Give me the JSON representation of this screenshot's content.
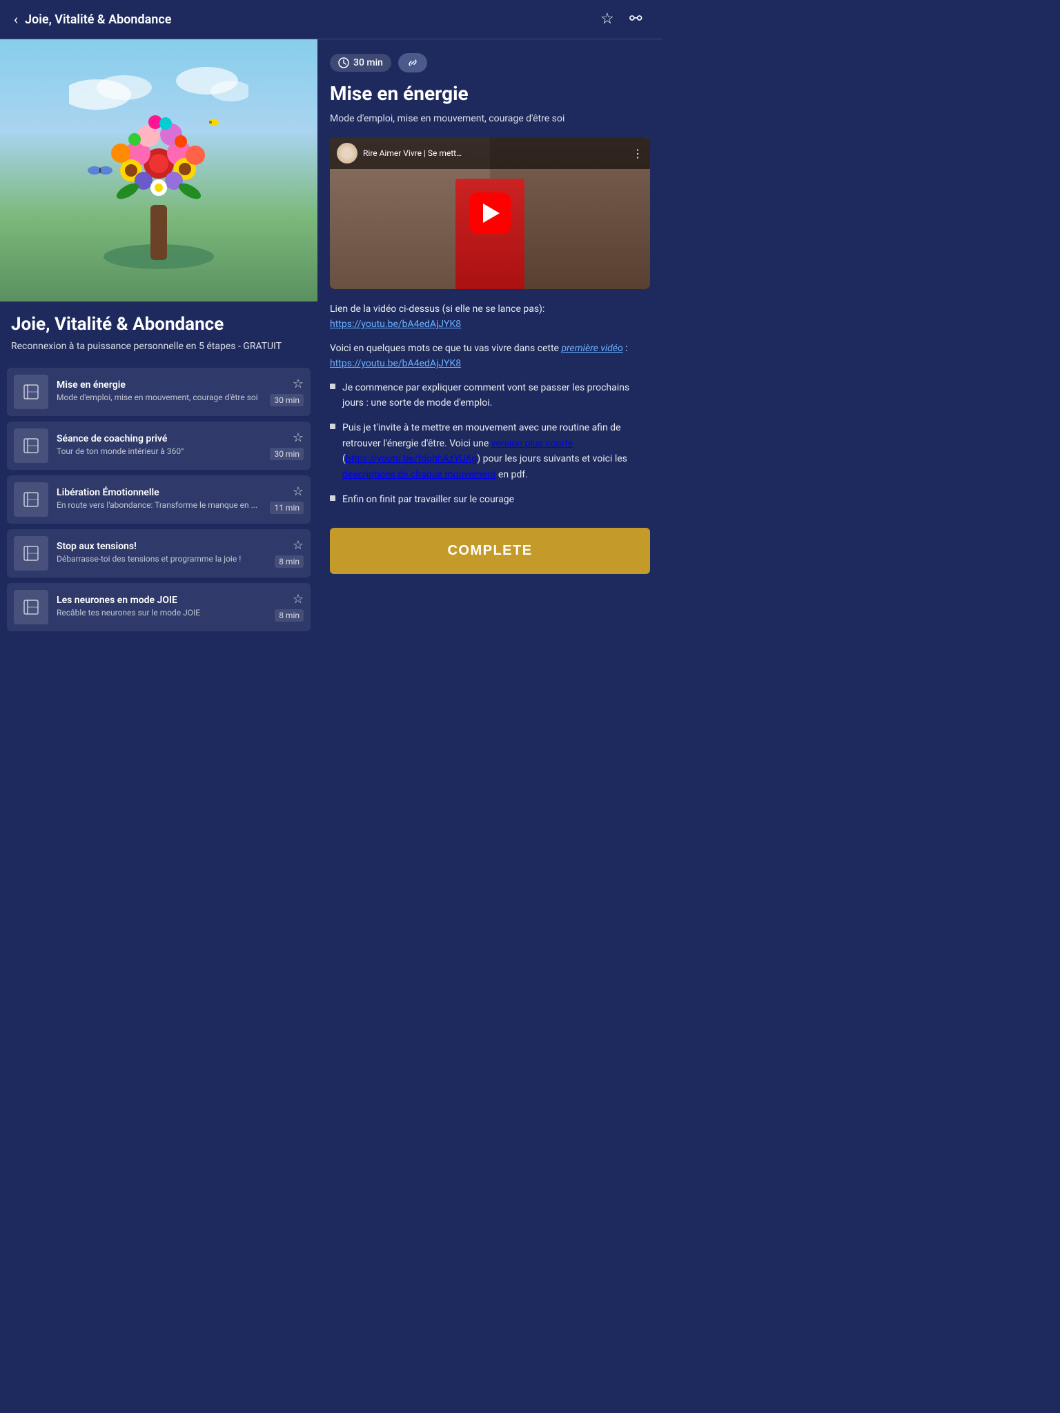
{
  "header": {
    "back_label": "‹",
    "title": "Joie, Vitalité & Abondance",
    "star_icon": "☆",
    "link_icon": "⚯"
  },
  "hero": {
    "alt": "Flower tree illustration"
  },
  "course": {
    "title": "Joie, Vitalité & Abondance",
    "subtitle": "Reconnexion à ta puissance personnelle en  5 étapes - GRATUIT"
  },
  "lessons": [
    {
      "name": "Mise en énergie",
      "desc": "Mode d'emploi, mise en mouvement, courage d'être soi",
      "duration": "30 min",
      "active": true
    },
    {
      "name": "Séance de coaching privé",
      "desc": "Tour de ton monde intérieur à 360°",
      "duration": "30 min",
      "active": false
    },
    {
      "name": "Libération Émotionnelle",
      "desc": "En route vers l'abondance: Transforme le manque en ...",
      "duration": "11 min",
      "active": false
    },
    {
      "name": "Stop aux tensions!",
      "desc": "Débarrasse-toi des tensions et programme la joie !",
      "duration": "8 min",
      "active": false
    },
    {
      "name": "Les neurones en mode JOIE",
      "desc": " Recâble tes neurones sur le mode JOIE",
      "duration": "8 min",
      "active": false
    }
  ],
  "detail": {
    "duration": "30 min",
    "title": "Mise en énergie",
    "description": "Mode d'emploi, mise en mouvement, courage d'être soi",
    "video": {
      "channel": "Rire Aimer Vivre | Se mett…",
      "channel_handle": "Rire Aimer Vivre"
    },
    "video_link_text": "Lien de la vidéo ci-dessus (si elle ne se lance pas): ",
    "video_link_url": "https://youtu.be/bA4edAjJYK8",
    "intro_text": "Voici en quelques mots ce que tu vas vivre dans cette ",
    "first_video_link_label": "première vidéo",
    "first_video_link_url": "https://youtu.be/bA4edAjJYK8",
    "first_video_link_url2": "https://youtu.be/bA4edAjJYK8",
    "bullets": [
      "Je commence par expliquer comment vont se passer les prochains jours : une sorte de mode d'emploi.",
      "Puis je t'invite à te mettre en mouvement avec une routine afin de retrouver l'énergie d'être. Voici une version plus courte (https://youtu.be/fdqhhAzYUAg) pour les jours suivants et voici les descriptions de chaque mouvement en pdf.",
      "Enfin on finit par travailler sur le courage"
    ],
    "bullet2_short_label": "version plus courte",
    "bullet2_short_url": "https://youtu.be/fdqhhAzYUAg",
    "bullet2_pdf_label": "descriptions de chaque mouvement",
    "bullet2_pdf_url": "#",
    "complete_label": "COMPLETE"
  }
}
